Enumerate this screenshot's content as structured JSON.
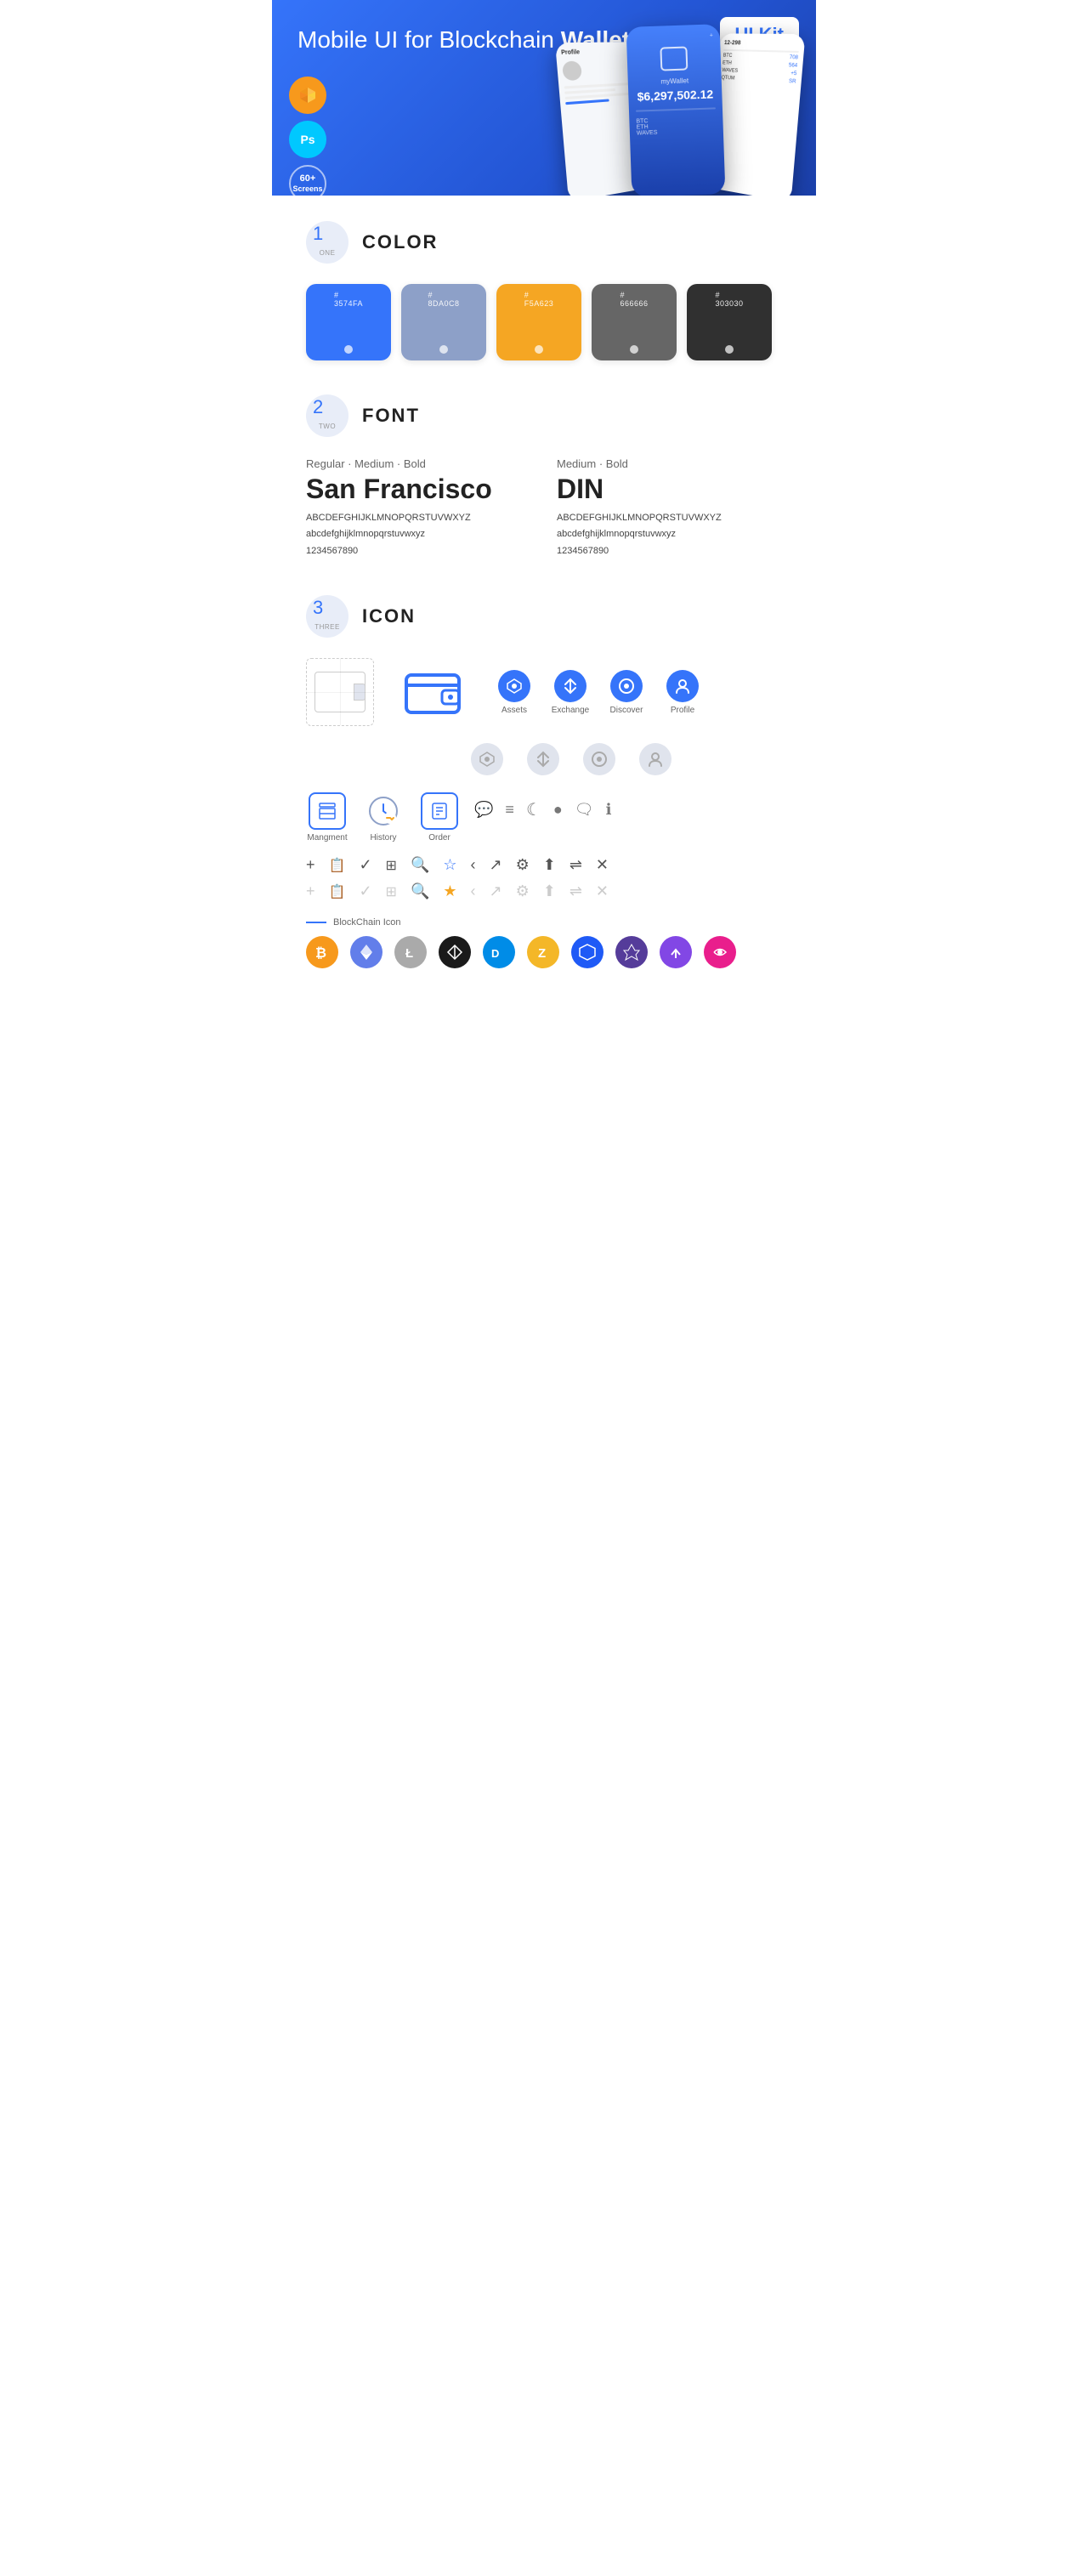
{
  "hero": {
    "title_normal": "Mobile UI for Blockchain ",
    "title_bold": "Wallet",
    "badge": "UI Kit",
    "sketch_label": "Sk",
    "ps_label": "Ps",
    "screens_label": "60+\nScreens"
  },
  "sections": {
    "color": {
      "number": "1",
      "word": "ONE",
      "title": "COLOR",
      "swatches": [
        {
          "hex": "#3574FA",
          "label": "3574FA"
        },
        {
          "hex": "#8DA0C8",
          "label": "8DA0C8"
        },
        {
          "hex": "#F5A623",
          "label": "F5A623"
        },
        {
          "hex": "#666666",
          "label": "666666"
        },
        {
          "hex": "#303030",
          "label": "303030"
        }
      ]
    },
    "font": {
      "number": "2",
      "word": "TWO",
      "title": "FONT",
      "fonts": [
        {
          "style": "Regular · Medium · Bold",
          "name": "San Francisco",
          "uppercase": "ABCDEFGHIJKLMNOPQRSTUVWXYZ",
          "lowercase": "abcdefghijklmnopqrstuvwxyz",
          "numbers": "1234567890"
        },
        {
          "style": "Medium · Bold",
          "name": "DIN",
          "uppercase": "ABCDEFGHIJKLMNOPQRSTUVWXYZ",
          "lowercase": "abcdefghijklmnopqrstuvwxyz",
          "numbers": "1234567890"
        }
      ]
    },
    "icon": {
      "number": "3",
      "word": "THREE",
      "title": "ICON",
      "main_icons": [
        {
          "label": "Assets"
        },
        {
          "label": "Exchange"
        },
        {
          "label": "Discover"
        },
        {
          "label": "Profile"
        }
      ],
      "app_icons": [
        {
          "label": "Mangment"
        },
        {
          "label": "History"
        },
        {
          "label": "Order"
        }
      ],
      "blockchain_label": "BlockChain Icon",
      "crypto_icons": [
        "BTC",
        "ETH",
        "LTC",
        "WING",
        "DASH",
        "ZEC",
        "WAVES",
        "AUG",
        "MATIC",
        "UNK"
      ]
    }
  }
}
